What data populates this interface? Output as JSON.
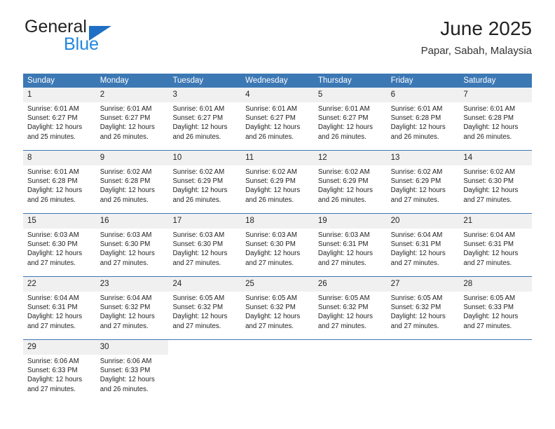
{
  "logo": {
    "word_top": "General",
    "word_bottom": "Blue",
    "triangle_color": "#1f6fc4",
    "blue_color": "#1f86e0"
  },
  "header": {
    "title": "June 2025",
    "subtitle": "Papar, Sabah, Malaysia"
  },
  "theme": {
    "header_blue": "#3c78b4",
    "day_band_gray": "#f0f0f0",
    "text": "#222222"
  },
  "weekdays": [
    "Sunday",
    "Monday",
    "Tuesday",
    "Wednesday",
    "Thursday",
    "Friday",
    "Saturday"
  ],
  "weeks": [
    [
      {
        "day": "1",
        "sunrise": "Sunrise: 6:01 AM",
        "sunset": "Sunset: 6:27 PM",
        "daylight1": "Daylight: 12 hours",
        "daylight2": "and 25 minutes."
      },
      {
        "day": "2",
        "sunrise": "Sunrise: 6:01 AM",
        "sunset": "Sunset: 6:27 PM",
        "daylight1": "Daylight: 12 hours",
        "daylight2": "and 26 minutes."
      },
      {
        "day": "3",
        "sunrise": "Sunrise: 6:01 AM",
        "sunset": "Sunset: 6:27 PM",
        "daylight1": "Daylight: 12 hours",
        "daylight2": "and 26 minutes."
      },
      {
        "day": "4",
        "sunrise": "Sunrise: 6:01 AM",
        "sunset": "Sunset: 6:27 PM",
        "daylight1": "Daylight: 12 hours",
        "daylight2": "and 26 minutes."
      },
      {
        "day": "5",
        "sunrise": "Sunrise: 6:01 AM",
        "sunset": "Sunset: 6:27 PM",
        "daylight1": "Daylight: 12 hours",
        "daylight2": "and 26 minutes."
      },
      {
        "day": "6",
        "sunrise": "Sunrise: 6:01 AM",
        "sunset": "Sunset: 6:28 PM",
        "daylight1": "Daylight: 12 hours",
        "daylight2": "and 26 minutes."
      },
      {
        "day": "7",
        "sunrise": "Sunrise: 6:01 AM",
        "sunset": "Sunset: 6:28 PM",
        "daylight1": "Daylight: 12 hours",
        "daylight2": "and 26 minutes."
      }
    ],
    [
      {
        "day": "8",
        "sunrise": "Sunrise: 6:01 AM",
        "sunset": "Sunset: 6:28 PM",
        "daylight1": "Daylight: 12 hours",
        "daylight2": "and 26 minutes."
      },
      {
        "day": "9",
        "sunrise": "Sunrise: 6:02 AM",
        "sunset": "Sunset: 6:28 PM",
        "daylight1": "Daylight: 12 hours",
        "daylight2": "and 26 minutes."
      },
      {
        "day": "10",
        "sunrise": "Sunrise: 6:02 AM",
        "sunset": "Sunset: 6:29 PM",
        "daylight1": "Daylight: 12 hours",
        "daylight2": "and 26 minutes."
      },
      {
        "day": "11",
        "sunrise": "Sunrise: 6:02 AM",
        "sunset": "Sunset: 6:29 PM",
        "daylight1": "Daylight: 12 hours",
        "daylight2": "and 26 minutes."
      },
      {
        "day": "12",
        "sunrise": "Sunrise: 6:02 AM",
        "sunset": "Sunset: 6:29 PM",
        "daylight1": "Daylight: 12 hours",
        "daylight2": "and 26 minutes."
      },
      {
        "day": "13",
        "sunrise": "Sunrise: 6:02 AM",
        "sunset": "Sunset: 6:29 PM",
        "daylight1": "Daylight: 12 hours",
        "daylight2": "and 27 minutes."
      },
      {
        "day": "14",
        "sunrise": "Sunrise: 6:02 AM",
        "sunset": "Sunset: 6:30 PM",
        "daylight1": "Daylight: 12 hours",
        "daylight2": "and 27 minutes."
      }
    ],
    [
      {
        "day": "15",
        "sunrise": "Sunrise: 6:03 AM",
        "sunset": "Sunset: 6:30 PM",
        "daylight1": "Daylight: 12 hours",
        "daylight2": "and 27 minutes."
      },
      {
        "day": "16",
        "sunrise": "Sunrise: 6:03 AM",
        "sunset": "Sunset: 6:30 PM",
        "daylight1": "Daylight: 12 hours",
        "daylight2": "and 27 minutes."
      },
      {
        "day": "17",
        "sunrise": "Sunrise: 6:03 AM",
        "sunset": "Sunset: 6:30 PM",
        "daylight1": "Daylight: 12 hours",
        "daylight2": "and 27 minutes."
      },
      {
        "day": "18",
        "sunrise": "Sunrise: 6:03 AM",
        "sunset": "Sunset: 6:30 PM",
        "daylight1": "Daylight: 12 hours",
        "daylight2": "and 27 minutes."
      },
      {
        "day": "19",
        "sunrise": "Sunrise: 6:03 AM",
        "sunset": "Sunset: 6:31 PM",
        "daylight1": "Daylight: 12 hours",
        "daylight2": "and 27 minutes."
      },
      {
        "day": "20",
        "sunrise": "Sunrise: 6:04 AM",
        "sunset": "Sunset: 6:31 PM",
        "daylight1": "Daylight: 12 hours",
        "daylight2": "and 27 minutes."
      },
      {
        "day": "21",
        "sunrise": "Sunrise: 6:04 AM",
        "sunset": "Sunset: 6:31 PM",
        "daylight1": "Daylight: 12 hours",
        "daylight2": "and 27 minutes."
      }
    ],
    [
      {
        "day": "22",
        "sunrise": "Sunrise: 6:04 AM",
        "sunset": "Sunset: 6:31 PM",
        "daylight1": "Daylight: 12 hours",
        "daylight2": "and 27 minutes."
      },
      {
        "day": "23",
        "sunrise": "Sunrise: 6:04 AM",
        "sunset": "Sunset: 6:32 PM",
        "daylight1": "Daylight: 12 hours",
        "daylight2": "and 27 minutes."
      },
      {
        "day": "24",
        "sunrise": "Sunrise: 6:05 AM",
        "sunset": "Sunset: 6:32 PM",
        "daylight1": "Daylight: 12 hours",
        "daylight2": "and 27 minutes."
      },
      {
        "day": "25",
        "sunrise": "Sunrise: 6:05 AM",
        "sunset": "Sunset: 6:32 PM",
        "daylight1": "Daylight: 12 hours",
        "daylight2": "and 27 minutes."
      },
      {
        "day": "26",
        "sunrise": "Sunrise: 6:05 AM",
        "sunset": "Sunset: 6:32 PM",
        "daylight1": "Daylight: 12 hours",
        "daylight2": "and 27 minutes."
      },
      {
        "day": "27",
        "sunrise": "Sunrise: 6:05 AM",
        "sunset": "Sunset: 6:32 PM",
        "daylight1": "Daylight: 12 hours",
        "daylight2": "and 27 minutes."
      },
      {
        "day": "28",
        "sunrise": "Sunrise: 6:05 AM",
        "sunset": "Sunset: 6:33 PM",
        "daylight1": "Daylight: 12 hours",
        "daylight2": "and 27 minutes."
      }
    ],
    [
      {
        "day": "29",
        "sunrise": "Sunrise: 6:06 AM",
        "sunset": "Sunset: 6:33 PM",
        "daylight1": "Daylight: 12 hours",
        "daylight2": "and 27 minutes."
      },
      {
        "day": "30",
        "sunrise": "Sunrise: 6:06 AM",
        "sunset": "Sunset: 6:33 PM",
        "daylight1": "Daylight: 12 hours",
        "daylight2": "and 26 minutes."
      },
      {
        "day": "",
        "sunrise": "",
        "sunset": "",
        "daylight1": "",
        "daylight2": ""
      },
      {
        "day": "",
        "sunrise": "",
        "sunset": "",
        "daylight1": "",
        "daylight2": ""
      },
      {
        "day": "",
        "sunrise": "",
        "sunset": "",
        "daylight1": "",
        "daylight2": ""
      },
      {
        "day": "",
        "sunrise": "",
        "sunset": "",
        "daylight1": "",
        "daylight2": ""
      },
      {
        "day": "",
        "sunrise": "",
        "sunset": "",
        "daylight1": "",
        "daylight2": ""
      }
    ]
  ]
}
